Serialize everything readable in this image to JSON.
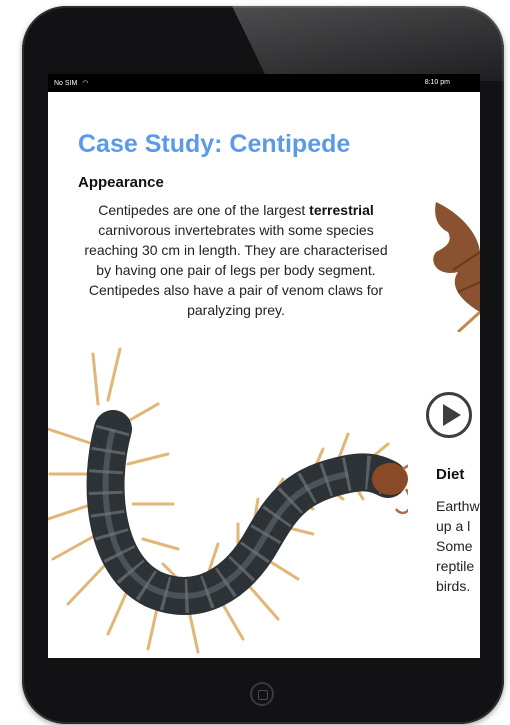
{
  "status_bar": {
    "carrier": "No SIM",
    "time": "8:10 pm",
    "wifi_icon": "wifi-icon"
  },
  "page": {
    "title": "Case Study: Centipede",
    "appearance": {
      "heading": "Appearance",
      "text_before": "Centipedes are one of the largest ",
      "text_bold": "terrestrial",
      "text_after": " carnivorous invertebrates with some species reaching 30 cm in length. They are characterised by having one pair of legs per body segment. Centipedes also have a pair of venom claws for paralyzing prey."
    },
    "diet": {
      "heading": "Diet",
      "lines": [
        "Earthw",
        "up a l",
        "Some",
        "reptile",
        "birds."
      ]
    },
    "play_icon": "play-icon"
  },
  "colors": {
    "title": "#5a9ae8",
    "device_bezel": "#121214"
  }
}
